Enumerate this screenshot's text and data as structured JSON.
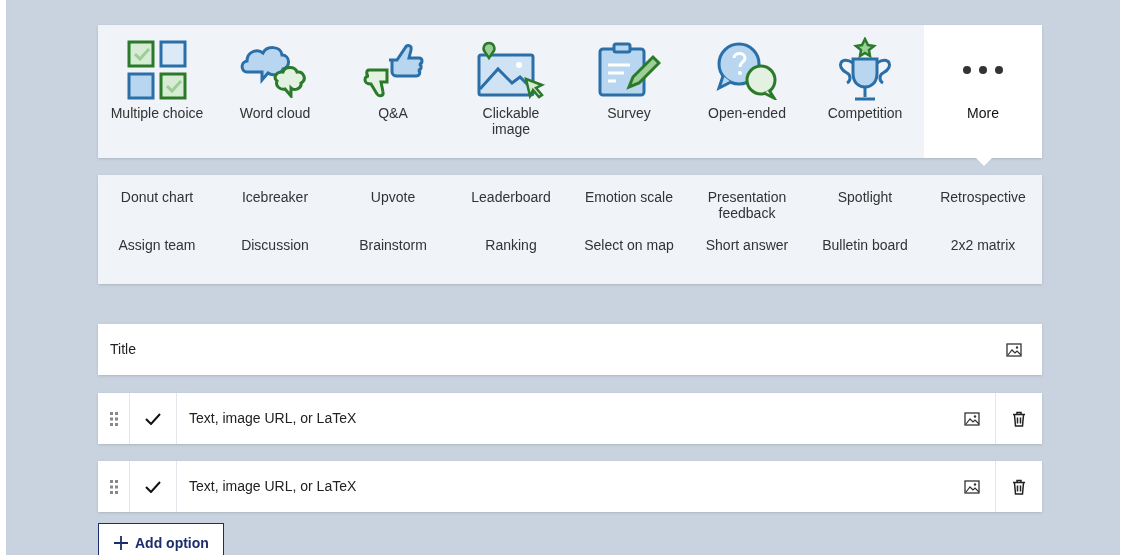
{
  "question_types": [
    {
      "label": "Multiple choice",
      "selected": false
    },
    {
      "label": "Word cloud",
      "selected": false
    },
    {
      "label": "Q&A",
      "selected": false
    },
    {
      "label": "Clickable image",
      "selected": false
    },
    {
      "label": "Survey",
      "selected": false
    },
    {
      "label": "Open-ended",
      "selected": false
    },
    {
      "label": "Competition",
      "selected": false
    },
    {
      "label": "More",
      "selected": true
    }
  ],
  "more_types": [
    "Donut chart",
    "Icebreaker",
    "Upvote",
    "Leaderboard",
    "Emotion scale",
    "Presentation feedback",
    "Spotlight",
    "Retrospective",
    "Assign team",
    "Discussion",
    "Brainstorm",
    "Ranking",
    "Select on map",
    "Short answer",
    "Bulletin board",
    "2x2 matrix"
  ],
  "title_field": {
    "placeholder": "Title"
  },
  "options": [
    {
      "placeholder": "Text, image URL, or LaTeX",
      "correct": true
    },
    {
      "placeholder": "Text, image URL, or LaTeX",
      "correct": true
    }
  ],
  "add_option_button": {
    "label": "Add option"
  }
}
